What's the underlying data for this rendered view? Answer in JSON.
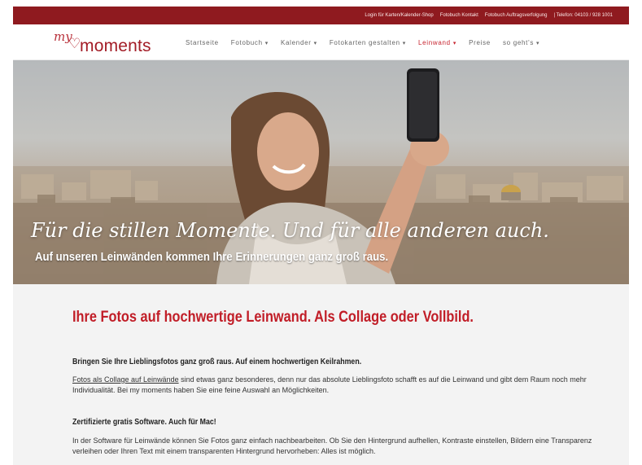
{
  "topbar": {
    "links": [
      "Login für Karten/Kalender-Shop",
      "Fotobuch Kontakt",
      "Fotobuch Auftragsverfolgung",
      "| Telefon: 04103 / 928 1001"
    ]
  },
  "logo": {
    "script": "my",
    "word": "moments"
  },
  "nav": {
    "items": [
      {
        "label": "Startseite",
        "caret": ""
      },
      {
        "label": "Fotobuch",
        "caret": "▾"
      },
      {
        "label": "Kalender",
        "caret": "▾"
      },
      {
        "label": "Fotokarten gestalten",
        "caret": "▾"
      },
      {
        "label": "Leinwand",
        "caret": "▾"
      },
      {
        "label": "Preise",
        "caret": ""
      },
      {
        "label": "so geht's",
        "caret": "▾"
      }
    ],
    "active": "Leinwand",
    "active_color": "#c7242f"
  },
  "hero": {
    "title": "Für die stillen Momente. Und für alle anderen auch.",
    "subtitle": "Auf unseren Leinwänden kommen Ihre Erinnerungen ganz groß raus."
  },
  "content": {
    "headline": "Ihre Fotos auf hochwertige Leinwand. Als Collage oder Vollbild.",
    "section1_title": "Bringen Sie Ihre Lieblingsfotos ganz groß raus. Auf einem hochwertigen Keilrahmen.",
    "section1_link": "Fotos als Collage auf Leinwände",
    "section1_text": " sind etwas ganz besonderes, denn nur das absolute Lieblingsfoto schafft es auf die Leinwand und gibt dem Raum noch mehr Individualität. Bei my moments haben Sie eine feine Auswahl an Möglichkeiten.",
    "section2_title": "Zertifizierte gratis Software. Auch für Mac!",
    "section2_text": "In der Software für Leinwände können Sie Fotos ganz einfach nachbearbeiten. Ob Sie den Hintergrund aufhellen, Kontraste einstellen, Bildern eine Transparenz verleihen oder Ihren Text mit einem transparenten Hintergrund hervorheben: Alles ist möglich."
  },
  "colors": {
    "brand_red": "#8f1a1f",
    "headline_red": "#c11d27"
  }
}
